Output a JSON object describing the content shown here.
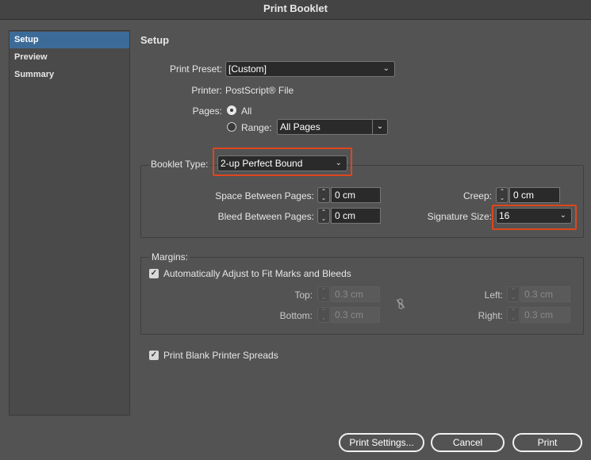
{
  "window": {
    "title": "Print Booklet"
  },
  "sidebar": {
    "items": [
      {
        "label": "Setup",
        "active": true
      },
      {
        "label": "Preview",
        "active": false
      },
      {
        "label": "Summary",
        "active": false
      }
    ]
  },
  "setup": {
    "heading": "Setup",
    "print_preset_label": "Print Preset:",
    "print_preset_value": "[Custom]",
    "printer_label": "Printer:",
    "printer_value": "PostScript® File",
    "pages_label": "Pages:",
    "all_label": "All",
    "range_label": "Range:",
    "range_value": "All Pages"
  },
  "booklet": {
    "type_label": "Booklet Type:",
    "type_value": "2-up Perfect Bound",
    "space_between_label": "Space Between Pages:",
    "space_between_value": "0 cm",
    "bleed_between_label": "Bleed Between Pages:",
    "bleed_between_value": "0 cm",
    "creep_label": "Creep:",
    "creep_value": "0 cm",
    "signature_label": "Signature Size:",
    "signature_value": "16"
  },
  "margins": {
    "heading": "Margins:",
    "auto_adjust_label": "Automatically Adjust to Fit Marks and Bleeds",
    "auto_adjust_checked": true,
    "top_label": "Top:",
    "top_value": "0.3 cm",
    "bottom_label": "Bottom:",
    "bottom_value": "0.3 cm",
    "left_label": "Left:",
    "left_value": "0.3 cm",
    "right_label": "Right:",
    "right_value": "0.3 cm"
  },
  "options": {
    "print_blank_label": "Print Blank Printer Spreads",
    "print_blank_checked": true
  },
  "footer": {
    "print_settings_label": "Print Settings...",
    "cancel_label": "Cancel",
    "print_label": "Print"
  },
  "colors": {
    "highlight": "#e0461d",
    "selection": "#3d6b98"
  }
}
